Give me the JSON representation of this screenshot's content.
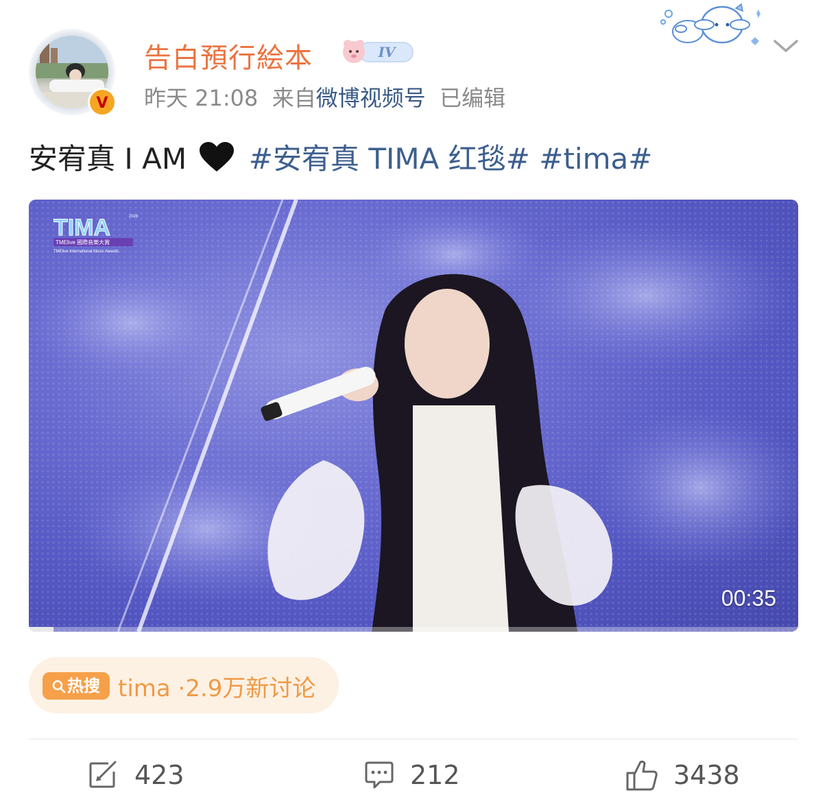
{
  "header": {
    "username": "告白預行絵本",
    "level_badge": "IV",
    "time": "昨天 21:08",
    "source_prefix": "来自",
    "source": "微博视频号",
    "edited": "已编辑",
    "verified_mark": "V"
  },
  "post": {
    "text": "安宥真 I AM",
    "hashtag1": "#安宥真 TIMA 红毯#",
    "hashtag2": "#tima#"
  },
  "video": {
    "duration": "00:35",
    "progress": 0.032,
    "logo_text": "TIMA",
    "logo_year": "2026",
    "logo_subtitle": "TMElive 國際音樂大賞",
    "logo_tagline": "TMElive International Music Awards"
  },
  "hot_search": {
    "badge": "热搜",
    "keyword": "tima",
    "detail": "·2.9万新讨论"
  },
  "actions": {
    "repost_count": "423",
    "comment_count": "212",
    "like_count": "3438"
  },
  "colors": {
    "username": "#eb7340",
    "hashtag": "#3d5f8d",
    "hot_accent": "#f6a04a",
    "verified": "#f5a623"
  }
}
